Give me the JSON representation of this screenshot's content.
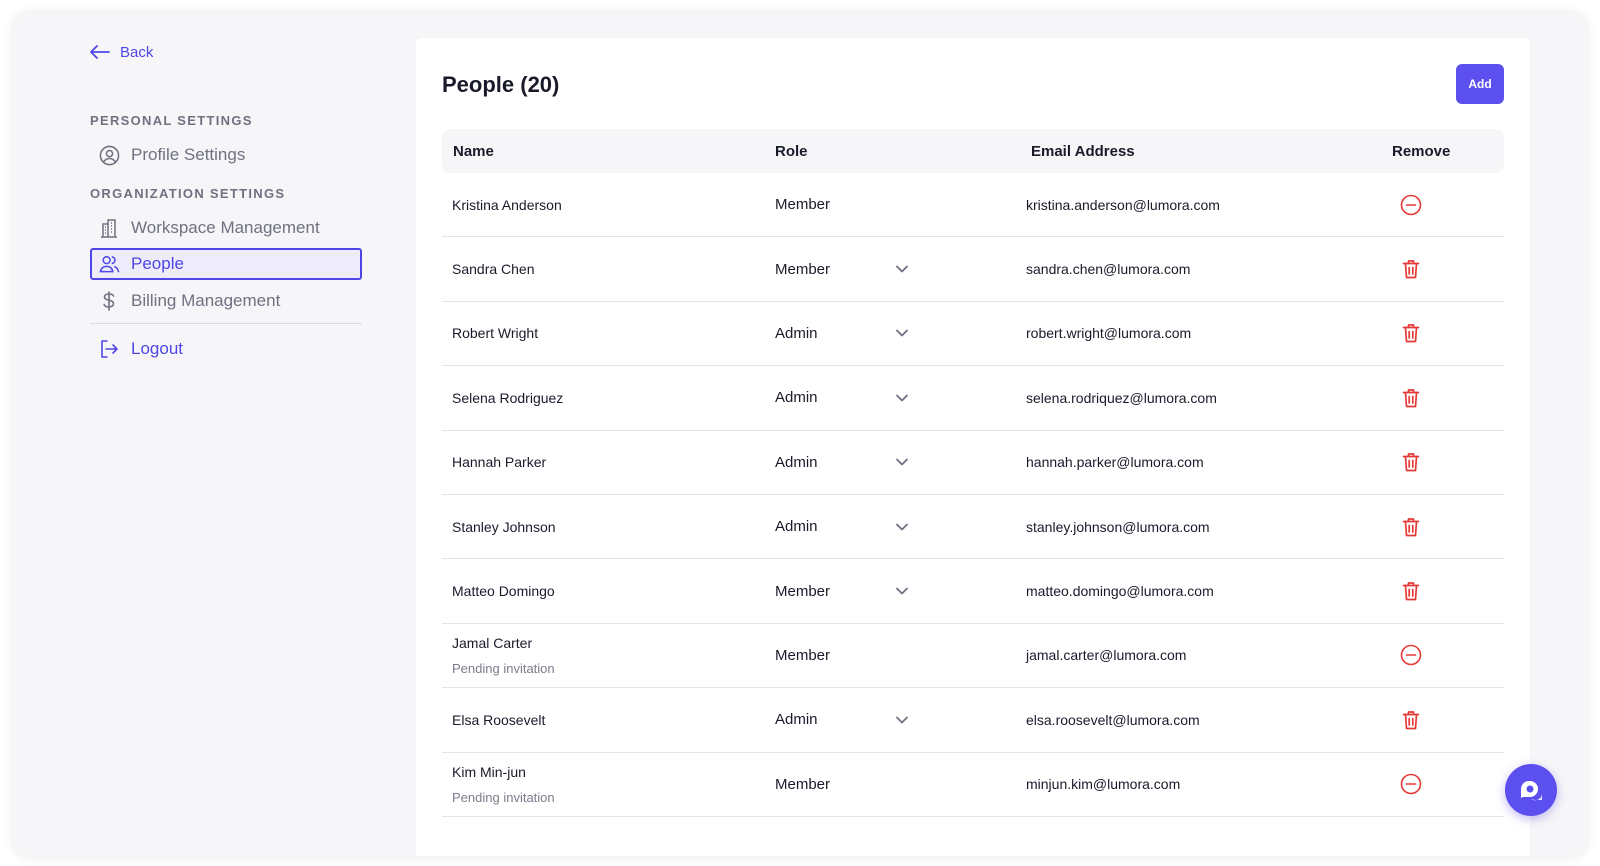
{
  "sidebar": {
    "back_label": "Back",
    "personal_title": "PERSONAL SETTINGS",
    "org_title": "ORGANIZATION SETTINGS",
    "items": {
      "profile": "Profile Settings",
      "workspace": "Workspace Management",
      "people": "People",
      "billing": "Billing Management",
      "logout": "Logout"
    }
  },
  "main": {
    "title": "People (20)",
    "add_label": "Add",
    "columns": {
      "name": "Name",
      "role": "Role",
      "email": "Email Address",
      "remove": "Remove"
    },
    "rows": [
      {
        "name": "Kristina Anderson",
        "sub": "",
        "role": "Member",
        "role_dropdown": false,
        "email": "kristina.anderson@lumora.com",
        "remove_icon": "minus-circle-icon"
      },
      {
        "name": "Sandra Chen",
        "sub": "",
        "role": "Member",
        "role_dropdown": true,
        "email": "sandra.chen@lumora.com",
        "remove_icon": "trash-icon"
      },
      {
        "name": "Robert Wright",
        "sub": "",
        "role": "Admin",
        "role_dropdown": true,
        "email": "robert.wright@lumora.com",
        "remove_icon": "trash-icon"
      },
      {
        "name": "Selena Rodriguez",
        "sub": "",
        "role": "Admin",
        "role_dropdown": true,
        "email": "selena.rodriquez@lumora.com",
        "remove_icon": "trash-icon"
      },
      {
        "name": "Hannah Parker",
        "sub": "",
        "role": "Admin",
        "role_dropdown": true,
        "email": "hannah.parker@lumora.com",
        "remove_icon": "trash-icon"
      },
      {
        "name": "Stanley Johnson",
        "sub": "",
        "role": "Admin",
        "role_dropdown": true,
        "email": "stanley.johnson@lumora.com",
        "remove_icon": "trash-icon"
      },
      {
        "name": "Matteo Domingo",
        "sub": "",
        "role": "Member",
        "role_dropdown": true,
        "email": "matteo.domingo@lumora.com",
        "remove_icon": "trash-icon"
      },
      {
        "name": "Jamal Carter",
        "sub": "Pending invitation",
        "role": "Member",
        "role_dropdown": false,
        "email": "jamal.carter@lumora.com",
        "remove_icon": "minus-circle-icon"
      },
      {
        "name": "Elsa Roosevelt",
        "sub": "",
        "role": "Admin",
        "role_dropdown": true,
        "email": "elsa.roosevelt@lumora.com",
        "remove_icon": "trash-icon"
      },
      {
        "name": "Kim Min-jun",
        "sub": "Pending invitation",
        "role": "Member",
        "role_dropdown": false,
        "email": "minjun.kim@lumora.com",
        "remove_icon": "minus-circle-icon"
      }
    ]
  },
  "colors": {
    "accent": "#4f46e5",
    "button": "#5b4ff0",
    "danger": "#e53935"
  },
  "chat_icon": "chat-bubble-icon"
}
